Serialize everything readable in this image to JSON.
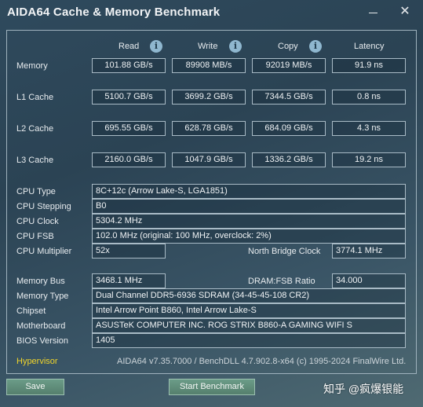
{
  "window": {
    "title": "AIDA64 Cache & Memory Benchmark"
  },
  "headers": {
    "read": "Read",
    "write": "Write",
    "copy": "Copy",
    "latency": "Latency"
  },
  "bench": [
    {
      "label": "Memory",
      "read": "101.88 GB/s",
      "write": "89908 MB/s",
      "copy": "92019 MB/s",
      "latency": "91.9 ns"
    },
    {
      "label": "L1 Cache",
      "read": "5100.7 GB/s",
      "write": "3699.2 GB/s",
      "copy": "7344.5 GB/s",
      "latency": "0.8 ns"
    },
    {
      "label": "L2 Cache",
      "read": "695.55 GB/s",
      "write": "628.78 GB/s",
      "copy": "684.09 GB/s",
      "latency": "4.3 ns"
    },
    {
      "label": "L3 Cache",
      "read": "2160.0 GB/s",
      "write": "1047.9 GB/s",
      "copy": "1336.2 GB/s",
      "latency": "19.2 ns"
    }
  ],
  "cpu": {
    "type_label": "CPU Type",
    "type": "8C+12c  (Arrow Lake-S, LGA1851)",
    "stepping_label": "CPU Stepping",
    "stepping": "B0",
    "clock_label": "CPU Clock",
    "clock": "5304.2 MHz",
    "fsb_label": "CPU FSB",
    "fsb": "102.0 MHz  (original: 100 MHz, overclock: 2%)",
    "multiplier_label": "CPU Multiplier",
    "multiplier": "52x",
    "nb_clock_label": "North Bridge Clock",
    "nb_clock": "3774.1 MHz"
  },
  "memory": {
    "bus_label": "Memory Bus",
    "bus": "3468.1 MHz",
    "ratio_label": "DRAM:FSB Ratio",
    "ratio": "34.000",
    "type_label": "Memory Type",
    "type": "Dual Channel DDR5-6936 SDRAM  (34-45-45-108 CR2)",
    "chipset_label": "Chipset",
    "chipset": "Intel Arrow Point B860, Intel Arrow Lake-S",
    "motherboard_label": "Motherboard",
    "motherboard": "ASUSTeK COMPUTER INC. ROG STRIX B860-A GAMING WIFI S",
    "bios_label": "BIOS Version",
    "bios": "1405"
  },
  "footer": {
    "hypervisor": "Hypervisor",
    "version": "AIDA64 v7.35.7000 / BenchDLL 4.7.902.8-x64  (c) 1995-2024 FinalWire Ltd."
  },
  "buttons": {
    "save": "Save",
    "start": "Start Benchmark"
  },
  "watermark": "知乎 @疯爆银能",
  "colors": {
    "accent": "#f0d42b",
    "button": "#6b9c88",
    "info_icon": "#8fb7cf"
  }
}
